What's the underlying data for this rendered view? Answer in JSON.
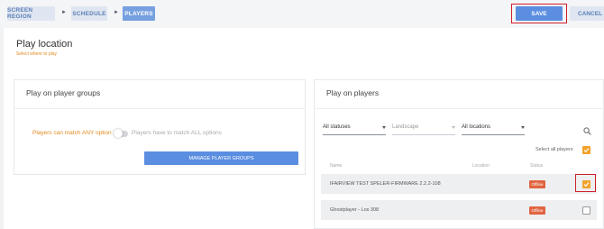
{
  "breadcrumbs": [
    {
      "label": "SCREEN REGION"
    },
    {
      "label": "SCHEDULE"
    },
    {
      "label": "PLAYERS"
    }
  ],
  "separator": "►",
  "toolbar": {
    "save_label": "SAVE",
    "cancel_label": "CANCEL"
  },
  "page": {
    "title": "Play location",
    "subtitle": "Select where to play"
  },
  "groups_card": {
    "title": "Play on player groups",
    "toggle_left_label": "Players can match ANY option",
    "toggle_right_label": "Players have to match ALL options",
    "toggle_on": false,
    "manage_label": "MANAGE PLAYER GROUPS"
  },
  "players_card": {
    "title": "Play on players",
    "filters": {
      "status": "All statuses",
      "orientation": "Landscape",
      "location": "All locations"
    },
    "select_all_label": "Select all players",
    "select_all_checked": true,
    "columns": {
      "name": "Name",
      "location": "Location",
      "status": "Status"
    },
    "rows": [
      {
        "name": "IFAIRVIEW TEST SPELER-FIRMWARE 2.2.2-108",
        "status": "Offline",
        "checked": true
      },
      {
        "name": "Ghostplayer - Los 308",
        "status": "Offline",
        "checked": false
      }
    ]
  },
  "colors": {
    "accent": "#5b8ee0",
    "warning": "#e08a1e",
    "offline": "#e0643f",
    "highlight": "#d01f2c",
    "checkbox": "#f2a22c"
  },
  "icons": {
    "search": "search-icon",
    "caret": "chevron-down-icon",
    "check": "check-icon"
  }
}
